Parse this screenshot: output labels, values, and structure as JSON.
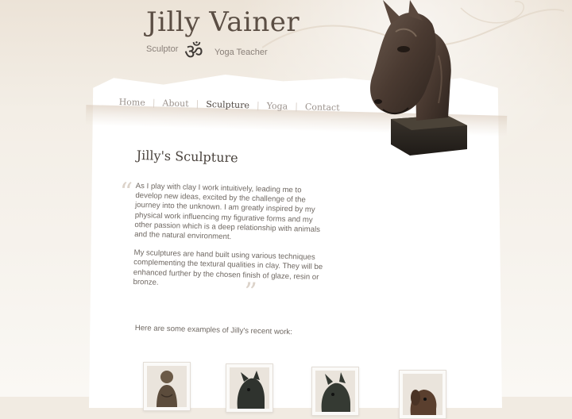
{
  "header": {
    "site_title": "Jilly Vainer",
    "tag_left": "Sculptor",
    "om_symbol": "ॐ",
    "tag_right": "Yoga Teacher"
  },
  "nav": {
    "items": [
      {
        "label": "Home"
      },
      {
        "label": "About"
      },
      {
        "label": "Sculpture",
        "active": true
      },
      {
        "label": "Yoga"
      },
      {
        "label": "Contact"
      }
    ]
  },
  "main": {
    "title": "Jilly's Sculpture",
    "quote_open": "“",
    "quote_close": "”",
    "paragraph_1": "As I play with clay I work intuitively, leading me to develop new ideas, excited by the challenge of the journey into the unknown. I am greatly inspired by my physical work influencing my figurative forms and my other passion which is a deep relationship with animals and the natural environment.",
    "paragraph_2": "My sculptures are hand built using various techniques complementing the textural qualities in clay. They will be enhanced further by the chosen finish of glaze, resin or bronze.",
    "recent_intro": "Here are some examples of Jilly's recent work:"
  },
  "thumbnails": [
    {
      "subject": "buddha-sculpture"
    },
    {
      "subject": "horse-head-sculpture"
    },
    {
      "subject": "horse-head-sculpture"
    },
    {
      "subject": "dog-head-sculpture"
    }
  ],
  "colors": {
    "background": "#f1ebe2",
    "title": "#5b4e44",
    "nav_active": "#4e4640",
    "nav_inactive": "#9b928c",
    "text": "#6f6862",
    "bronze": "#4a3a31"
  }
}
